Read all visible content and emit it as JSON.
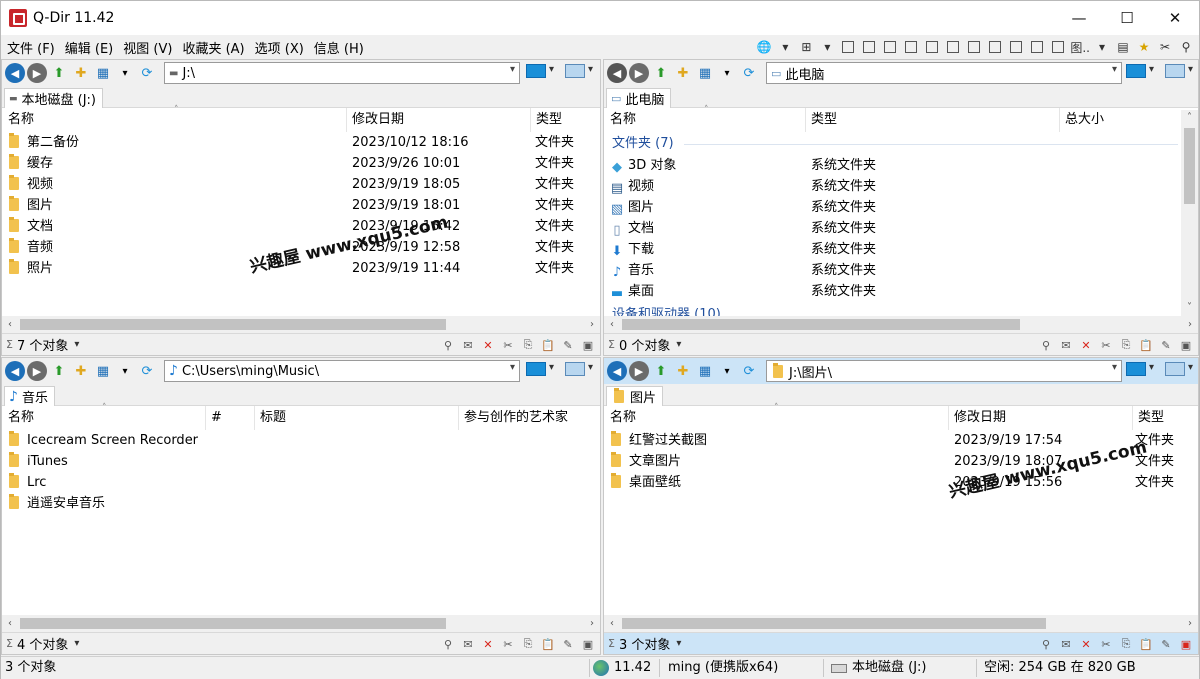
{
  "window": {
    "title": "Q-Dir 11.42",
    "minimize": "—",
    "maximize": "☐",
    "close": "✕"
  },
  "menu": [
    "文件 (F)",
    "编辑 (E)",
    "视图 (V)",
    "收藏夹 (A)",
    "选项 (X)",
    "信息 (H)"
  ],
  "toolbar_label": "图..",
  "panes": {
    "top_left": {
      "address": "J:\\",
      "tab": "本地磁盘 (J:)",
      "columns": [
        "名称",
        "修改日期",
        "类型"
      ],
      "rows": [
        {
          "name": "第二备份",
          "date": "2023/10/12 18:16",
          "type": "文件夹"
        },
        {
          "name": "缓存",
          "date": "2023/9/26 10:01",
          "type": "文件夹"
        },
        {
          "name": "视频",
          "date": "2023/9/19 18:05",
          "type": "文件夹"
        },
        {
          "name": "图片",
          "date": "2023/9/19 18:01",
          "type": "文件夹"
        },
        {
          "name": "文档",
          "date": "2023/9/19 16:42",
          "type": "文件夹"
        },
        {
          "name": "音频",
          "date": "2023/9/19 12:58",
          "type": "文件夹"
        },
        {
          "name": "照片",
          "date": "2023/9/19 11:44",
          "type": "文件夹"
        }
      ],
      "status": "7 个对象"
    },
    "top_right": {
      "address": "此电脑",
      "tab": "此电脑",
      "columns": [
        "名称",
        "类型",
        "总大小"
      ],
      "group": "文件夹 (7)",
      "group2": "设备和驱动器 (10)",
      "rows": [
        {
          "name": "3D 对象",
          "type": "系统文件夹",
          "icon": "cube-icon"
        },
        {
          "name": "视频",
          "type": "系统文件夹",
          "icon": "video-icon"
        },
        {
          "name": "图片",
          "type": "系统文件夹",
          "icon": "picture-icon"
        },
        {
          "name": "文档",
          "type": "系统文件夹",
          "icon": "document-icon"
        },
        {
          "name": "下载",
          "type": "系统文件夹",
          "icon": "download-icon"
        },
        {
          "name": "音乐",
          "type": "系统文件夹",
          "icon": "music-icon"
        },
        {
          "name": "桌面",
          "type": "系统文件夹",
          "icon": "desktop-icon"
        }
      ],
      "status": "0 个对象"
    },
    "bottom_left": {
      "address": "C:\\Users\\ming\\Music\\",
      "tab": "音乐",
      "columns": [
        "名称",
        "#",
        "标题",
        "参与创作的艺术家"
      ],
      "rows": [
        {
          "name": "Icecream Screen Recorder"
        },
        {
          "name": "iTunes"
        },
        {
          "name": "Lrc"
        },
        {
          "name": "逍遥安卓音乐"
        }
      ],
      "status": "4 个对象"
    },
    "bottom_right": {
      "address": "J:\\图片\\",
      "tab": "图片",
      "columns": [
        "名称",
        "修改日期",
        "类型"
      ],
      "rows": [
        {
          "name": "红警过关截图",
          "date": "2023/9/19 17:54",
          "type": "文件夹"
        },
        {
          "name": "文章图片",
          "date": "2023/9/19 18:07",
          "type": "文件夹"
        },
        {
          "name": "桌面壁纸",
          "date": "2023/9/19 15:56",
          "type": "文件夹"
        }
      ],
      "status": "3 个对象"
    }
  },
  "watermark": "兴趣屋 www.xqu5.com",
  "app_status": {
    "objects": "3 个对象",
    "version": "11.42",
    "user": "ming (便携版x64)",
    "drive": "本地磁盘 (J:)",
    "free": "空闲: 254 GB 在 820 GB"
  },
  "colors": {
    "active_pane": "#cce4f7",
    "folder": "#f2c24e",
    "group_text": "#1f4e9c"
  }
}
